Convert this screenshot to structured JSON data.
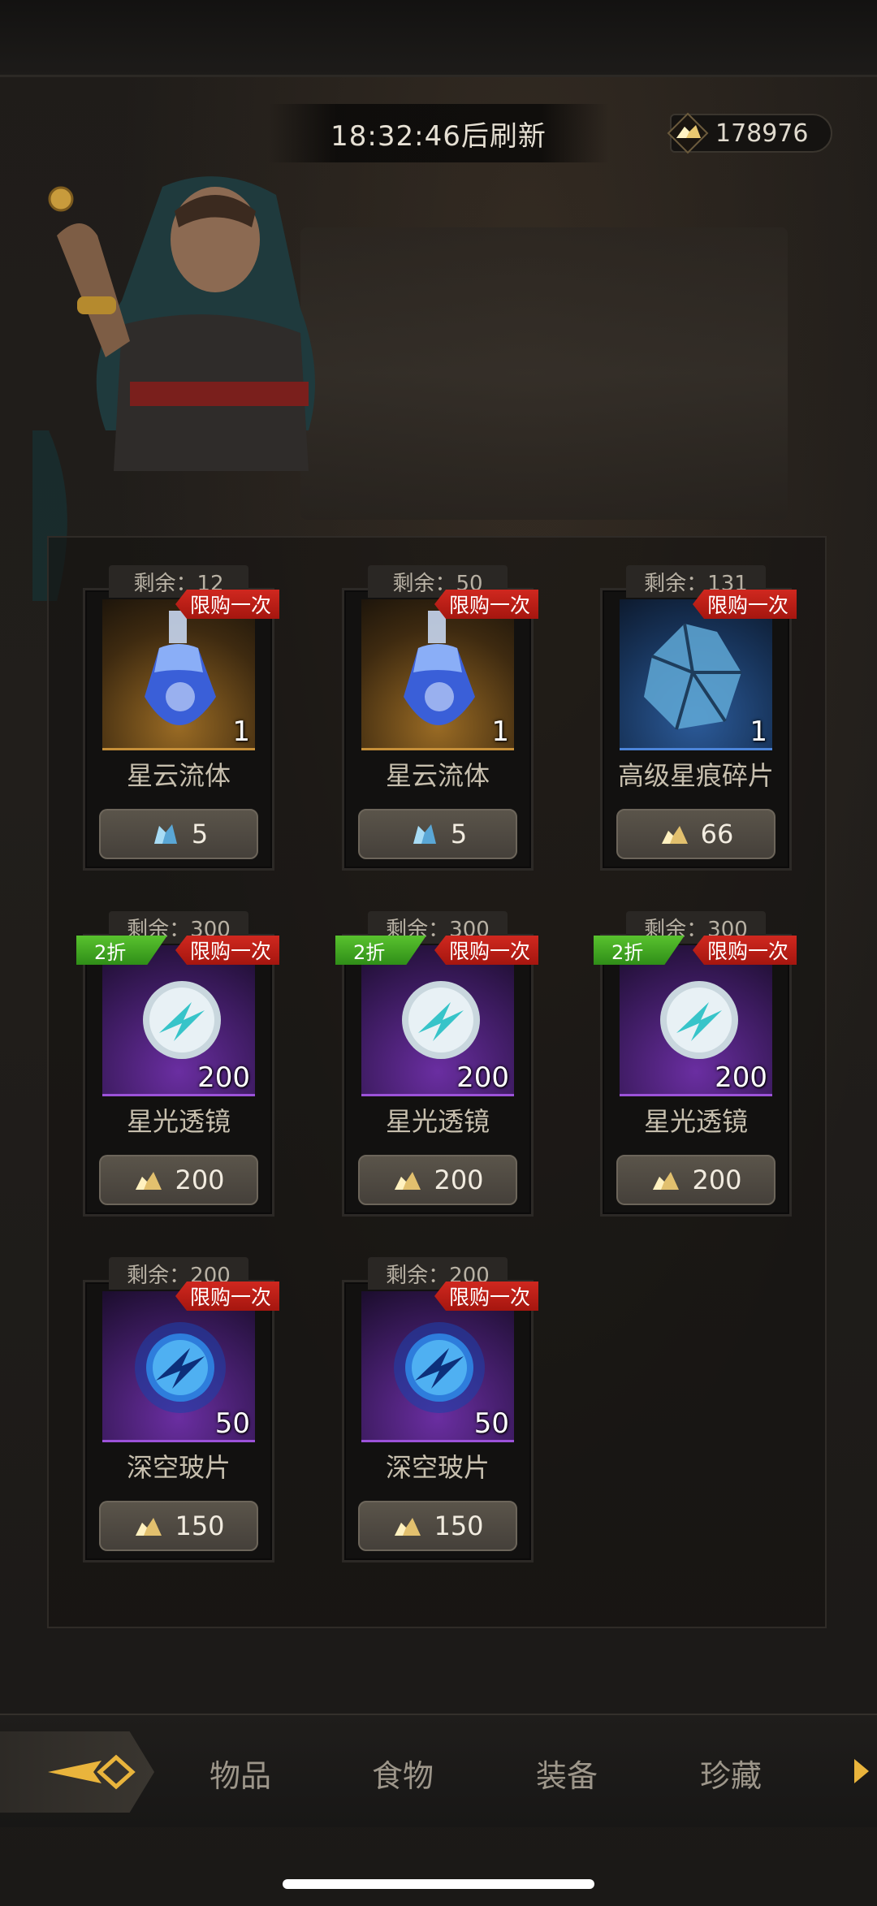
{
  "header": {
    "refresh_text": "18:32:46后刷新",
    "currency_amount": "178976",
    "currency_icon": "gold-crystal-icon"
  },
  "items": [
    {
      "remaining": "剩余：12",
      "tag_limit": "限购一次",
      "discount": null,
      "quantity": "1",
      "name": "星云流体",
      "price": "5",
      "price_currency": "blue-crystal-icon",
      "rarity": "gold",
      "icon": "potion-icon"
    },
    {
      "remaining": "剩余：50",
      "tag_limit": "限购一次",
      "discount": null,
      "quantity": "1",
      "name": "星云流体",
      "price": "5",
      "price_currency": "blue-crystal-icon",
      "rarity": "gold",
      "icon": "potion-icon"
    },
    {
      "remaining": "剩余：131",
      "tag_limit": "限购一次",
      "discount": null,
      "quantity": "1",
      "name": "高级星痕碎片",
      "price": "66",
      "price_currency": "gold-crystal-icon",
      "rarity": "blue",
      "icon": "crystal-shard-icon"
    },
    {
      "remaining": "剩余：300",
      "tag_limit": "限购一次",
      "discount": "2折",
      "quantity": "200",
      "name": "星光透镜",
      "price": "200",
      "price_currency": "gold-crystal-icon",
      "rarity": "purple",
      "icon": "white-orb-icon"
    },
    {
      "remaining": "剩余：300",
      "tag_limit": "限购一次",
      "discount": "2折",
      "quantity": "200",
      "name": "星光透镜",
      "price": "200",
      "price_currency": "gold-crystal-icon",
      "rarity": "purple",
      "icon": "white-orb-icon"
    },
    {
      "remaining": "剩余：300",
      "tag_limit": "限购一次",
      "discount": "2折",
      "quantity": "200",
      "name": "星光透镜",
      "price": "200",
      "price_currency": "gold-crystal-icon",
      "rarity": "purple",
      "icon": "white-orb-icon"
    },
    {
      "remaining": "剩余：200",
      "tag_limit": "限购一次",
      "discount": null,
      "quantity": "50",
      "name": "深空玻片",
      "price": "150",
      "price_currency": "gold-crystal-icon",
      "rarity": "purple",
      "icon": "blue-orb-icon"
    },
    {
      "remaining": "剩余：200",
      "tag_limit": "限购一次",
      "discount": null,
      "quantity": "50",
      "name": "深空玻片",
      "price": "150",
      "price_currency": "gold-crystal-icon",
      "rarity": "purple",
      "icon": "blue-orb-icon"
    }
  ],
  "tabs": [
    {
      "label": "物品"
    },
    {
      "label": "食物"
    },
    {
      "label": "装备"
    },
    {
      "label": "珍藏"
    }
  ],
  "colors": {
    "limit_tag": "#c41f17",
    "discount_tag": "#4aad25",
    "rarity_gold": "#c58f39",
    "rarity_blue": "#4c84d8",
    "rarity_purple": "#9c52d9"
  }
}
